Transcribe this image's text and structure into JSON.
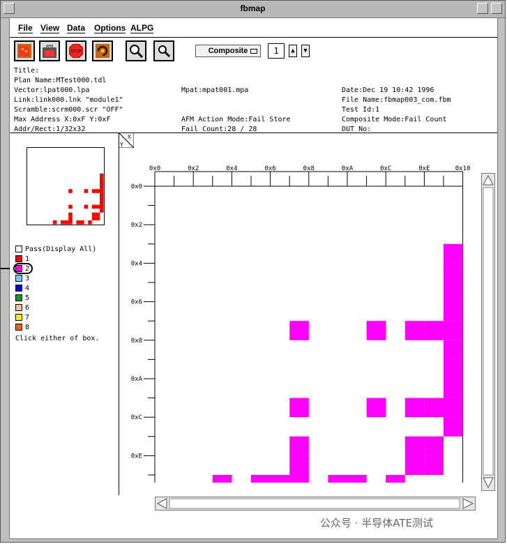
{
  "window": {
    "title": "fbmap"
  },
  "menu": [
    {
      "label": "File"
    },
    {
      "label": "View"
    },
    {
      "label": "Data"
    },
    {
      "label": "Options"
    },
    {
      "label": "ALPG"
    }
  ],
  "toolbar": {
    "buttons": [
      "map-icon",
      "afm-icon",
      "stop-icon",
      "refresh-icon",
      "zoom-in-icon",
      "zoom-out-icon"
    ],
    "stop_label": "STOP",
    "afm_label": "AFM",
    "mode_value": "Composite",
    "number_value": "1",
    "spin_up": "▲",
    "spin_down": "▼"
  },
  "info": {
    "title": "Title:",
    "plan_name": "Plan Name:MTest000.tdl",
    "vector": "Vector:lpat000.lpa",
    "mpat": "Mpat:mpat001.mpa",
    "date": "Date:Dec 19 10:42 1996",
    "link": "Link:link000.lnk \"module1\"",
    "file_name": "File Name:fbmap003_com.fbm",
    "scramble": "Scramble:scrm000.scr \"OFF\"",
    "test_id": "Test Id:1",
    "max_address": "Max Address X:0xF Y:0xF",
    "afm_action": "AFM Action Mode:Fail Store",
    "composite_mode": "Composite Mode:Fail Count",
    "addr_rect": "Addr/Rect:1/32x32",
    "fail_count": "Fail Count:28 / 28",
    "dut_no": "DUT No:"
  },
  "legend": {
    "items": [
      {
        "label": "Pass(Display All)",
        "color": "#ffffff"
      },
      {
        "label": "1",
        "color": "#ff0000"
      },
      {
        "label": "2",
        "color": "#ff00ff"
      },
      {
        "label": "3",
        "color": "#66ccff"
      },
      {
        "label": "4",
        "color": "#0000ff"
      },
      {
        "label": "5",
        "color": "#009933"
      },
      {
        "label": "6",
        "color": "#f0c090"
      },
      {
        "label": "7",
        "color": "#ffee00"
      },
      {
        "label": "8",
        "color": "#ee6600"
      }
    ],
    "hint": "Click either of box."
  },
  "axes": {
    "corner_x": "X",
    "corner_y": "Y",
    "x_ticks": [
      "0x0",
      "0x2",
      "0x4",
      "0x6",
      "0x8",
      "0xA",
      "0xC",
      "0xE",
      "0x10"
    ],
    "y_ticks": [
      "0x0",
      "0x2",
      "0x4",
      "0x6",
      "0x8",
      "0xA",
      "0xC",
      "0xE",
      "0x10"
    ]
  },
  "map": {
    "cells": [
      [
        15,
        3
      ],
      [
        15,
        4
      ],
      [
        15,
        5
      ],
      [
        15,
        6
      ],
      [
        15,
        7
      ],
      [
        15,
        8
      ],
      [
        15,
        9
      ],
      [
        15,
        10
      ],
      [
        15,
        11
      ],
      [
        15,
        12
      ],
      [
        7,
        7
      ],
      [
        11,
        7
      ],
      [
        13,
        7
      ],
      [
        14,
        7
      ],
      [
        7,
        11
      ],
      [
        11,
        11
      ],
      [
        13,
        11
      ],
      [
        14,
        11
      ],
      [
        7,
        13
      ],
      [
        13,
        13
      ],
      [
        14,
        13
      ],
      [
        7,
        14
      ],
      [
        13,
        14
      ],
      [
        14,
        14
      ],
      [
        3,
        15
      ],
      [
        5,
        15
      ],
      [
        6,
        15
      ],
      [
        7,
        15
      ],
      [
        9,
        15
      ],
      [
        10,
        15
      ],
      [
        12,
        15
      ]
    ],
    "color": "#ff00ff",
    "mini_color": "#ff0000"
  },
  "watermark": "公众号 · 半导体ATE测试"
}
